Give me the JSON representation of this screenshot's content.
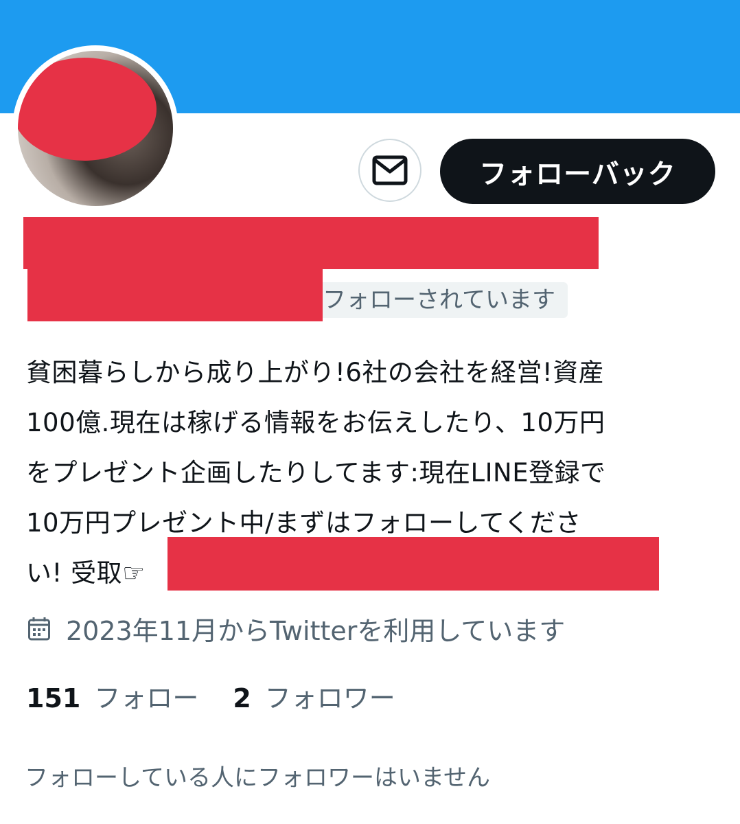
{
  "profile": {
    "follow_button_label": "フォローバック",
    "followed_badge": "フォローされています",
    "bio_lines": [
      "貧困暮らしから成り上がり!6社の会社を経営!資産",
      "100億.現在は稼げる情報をお伝えしたり、10万円",
      "をプレゼント企画したりしてます:現在LINE登録で",
      "10万円プレゼント中/まずはフォローしてくださ",
      "い! 受取☞"
    ],
    "joined": "2023年11月からTwitterを利用しています",
    "following_count": "151",
    "following_label": "フォロー",
    "followers_count": "2",
    "followers_label": "フォロワー",
    "no_followers_note": "フォローしている人にフォロワーはいません"
  },
  "icons": {
    "message": "mail-icon",
    "joined": "calendar-icon"
  },
  "colors": {
    "banner": "#1d9bf0",
    "follow_button_bg": "#0f1419",
    "redaction": "#e63246",
    "secondary_text": "#536471"
  }
}
